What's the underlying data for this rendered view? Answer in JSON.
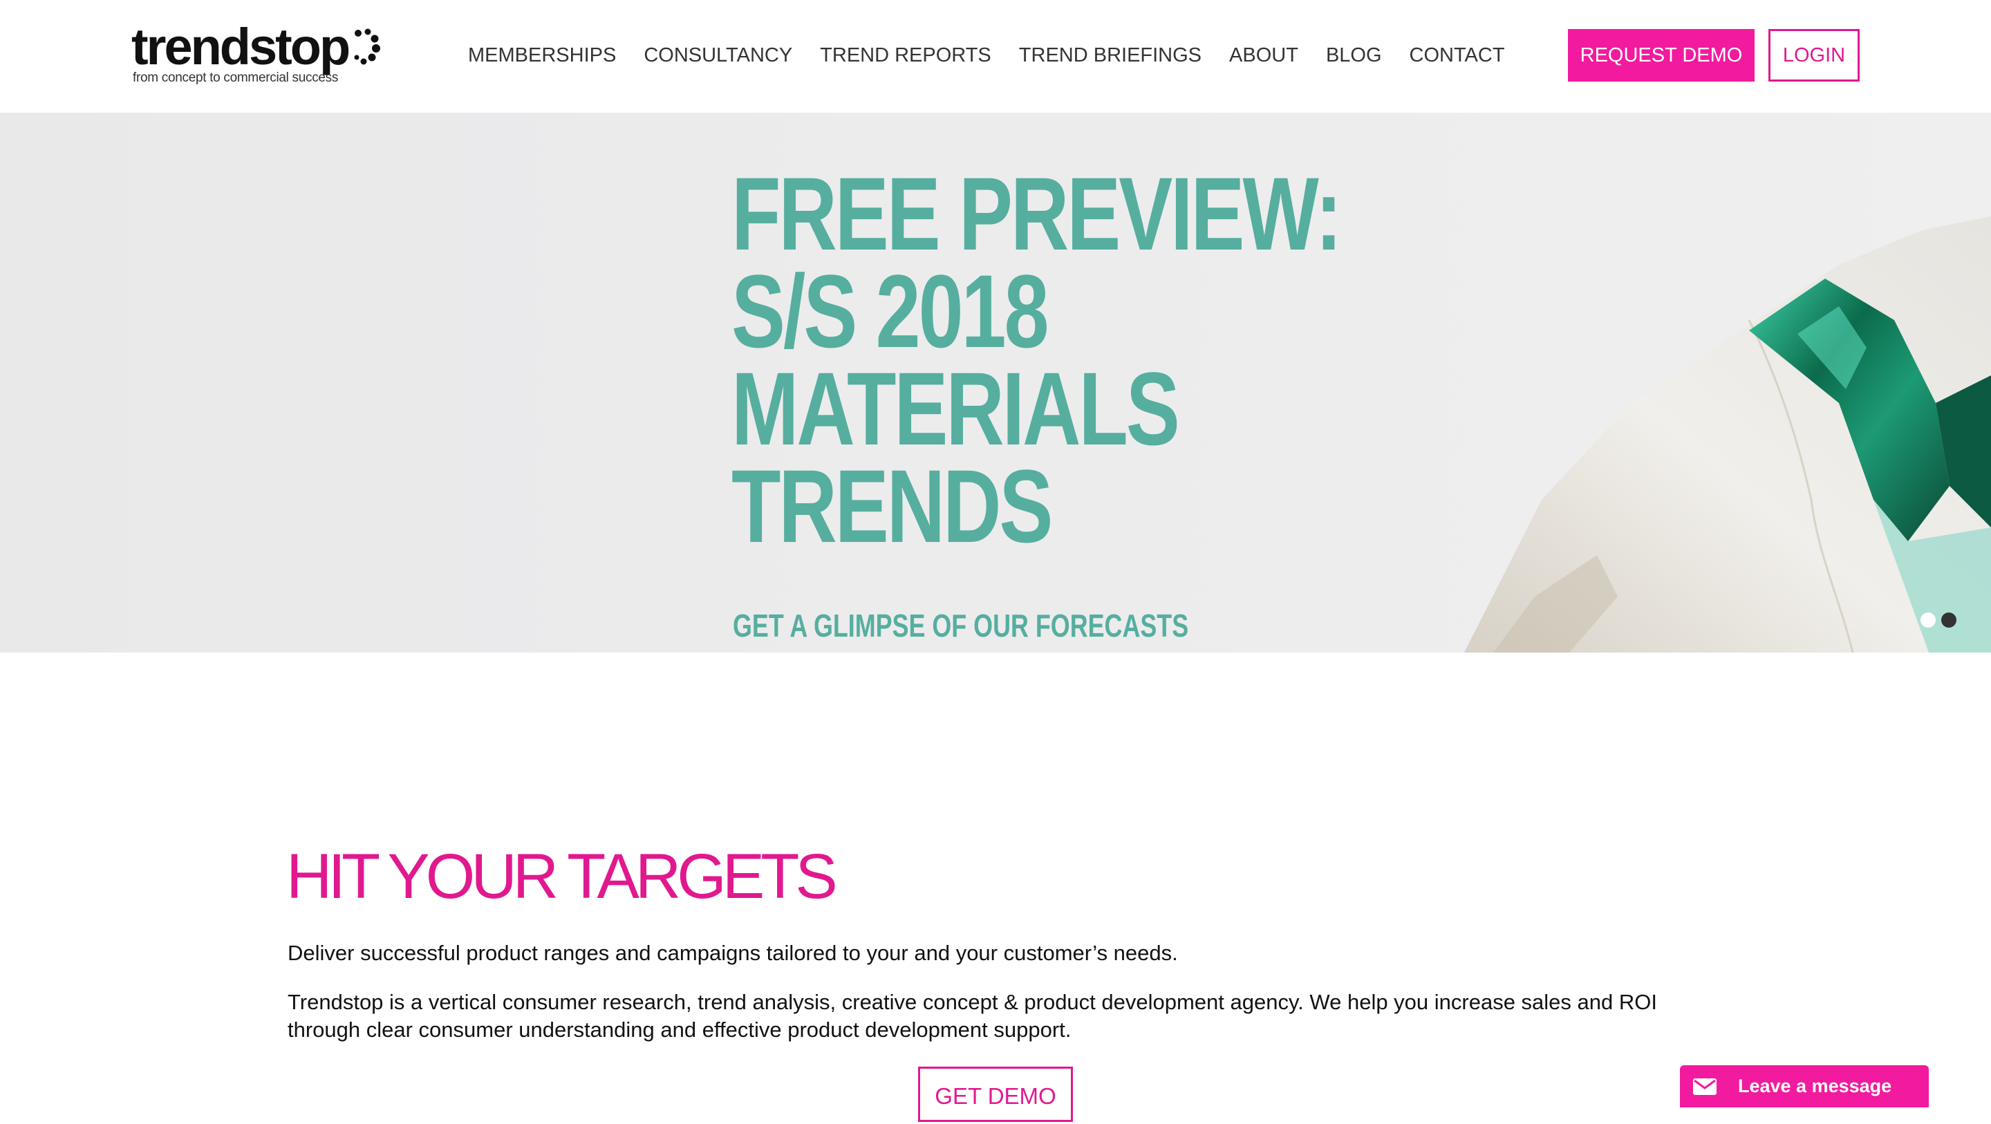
{
  "logo": {
    "wordmark": "trendstop",
    "tagline": "from concept to commercial success"
  },
  "nav": {
    "items": [
      {
        "label": "MEMBERSHIPS"
      },
      {
        "label": "CONSULTANCY"
      },
      {
        "label": "TREND REPORTS"
      },
      {
        "label": "TREND BRIEFINGS"
      },
      {
        "label": "ABOUT"
      },
      {
        "label": "BLOG"
      },
      {
        "label": "CONTACT"
      }
    ],
    "request_demo_label": "REQUEST DEMO",
    "login_label": "LOGIN"
  },
  "hero": {
    "title_lines": [
      "FREE PREVIEW:",
      "S/S 2018",
      "MATERIALS",
      "TRENDS"
    ],
    "subtitle": "GET A GLIMPSE OF OUR FORECASTS",
    "carousel": {
      "slides": 2,
      "active": 2
    }
  },
  "content": {
    "heading": "HIT YOUR TARGETS",
    "intro": "Deliver successful product ranges and campaigns tailored to your and your customer’s needs.",
    "description": "Trendstop is a vertical consumer research, trend analysis, creative concept & product development agency. We help you increase sales and ROI through clear consumer understanding and effective product development support.",
    "cta_label": "GET DEMO"
  },
  "chat": {
    "label": "Leave a message",
    "icon": "envelope-icon"
  },
  "colors": {
    "accent": "#f21a9e",
    "hero_text": "#56ae9f",
    "hero_bg": "#ececed"
  }
}
